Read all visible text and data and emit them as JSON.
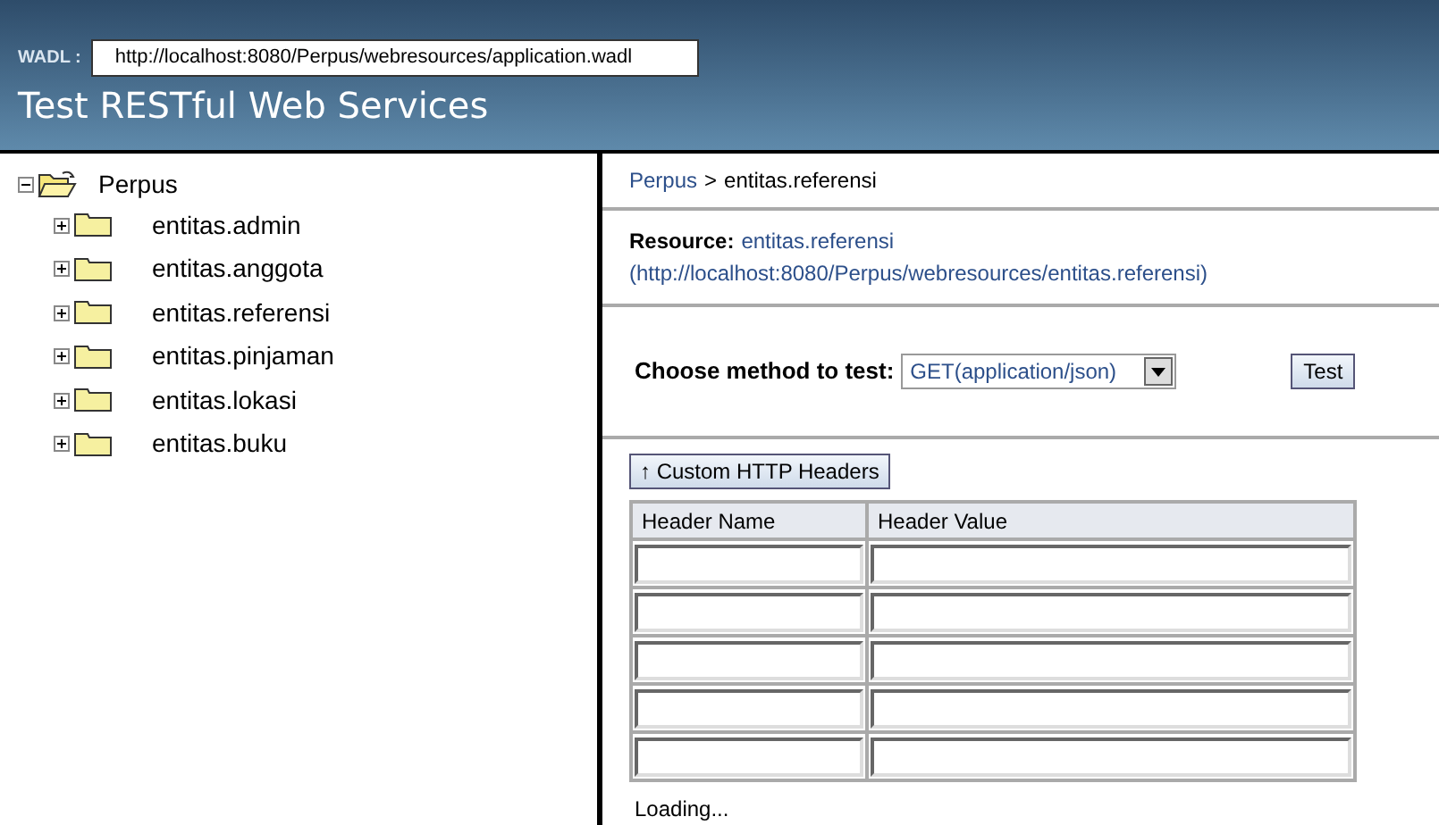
{
  "header": {
    "wadl_label": "WADL :",
    "wadl_url": "http://localhost:8080/Perpus/webresources/application.wadl",
    "title": "Test RESTful Web Services"
  },
  "tree": {
    "label": "Perpus",
    "expanded": true,
    "children": [
      {
        "label": "entitas.admin",
        "expanded": false
      },
      {
        "label": "entitas.anggota",
        "expanded": false
      },
      {
        "label": "entitas.referensi",
        "expanded": false
      },
      {
        "label": "entitas.pinjaman",
        "expanded": false
      },
      {
        "label": "entitas.lokasi",
        "expanded": false
      },
      {
        "label": "entitas.buku",
        "expanded": false
      }
    ]
  },
  "breadcrumb": {
    "root": "Perpus",
    "separator": ">",
    "current": "entitas.referensi"
  },
  "resource": {
    "label": "Resource:",
    "name": "entitas.referensi",
    "url": "(http://localhost:8080/Perpus/webresources/entitas.referensi)"
  },
  "method": {
    "label": "Choose method to test:",
    "value": "GET(application/json)",
    "test_button": "Test"
  },
  "headers": {
    "toggle": "↑ Custom HTTP Headers",
    "columns": [
      "Header Name",
      "Header Value"
    ],
    "rows": [
      {
        "kind": "input"
      },
      {
        "kind": "input"
      },
      {
        "kind": "input"
      },
      {
        "kind": "input"
      },
      {
        "kind": "input"
      }
    ]
  },
  "status": "Loading..."
}
